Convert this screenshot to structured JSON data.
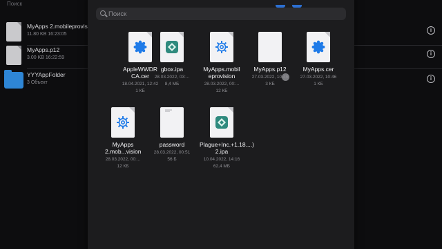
{
  "background_list": {
    "search_placeholder": "Поиск",
    "rows": [
      {
        "name": "MyApps 2.mobileprovision",
        "meta": "11.80 KB  16:23:05",
        "kind": "doc"
      },
      {
        "name": "MyApps.p12",
        "meta": "3.00 KB  16:22:59",
        "kind": "doc"
      },
      {
        "name": "YYYAppFolder",
        "meta": "3 Объект",
        "kind": "folder"
      }
    ]
  },
  "picker": {
    "search_placeholder": "Поиск",
    "files": [
      {
        "label": "AppleWWDRCA.cer",
        "date": "18.04.2021, 12:42",
        "size": "1 КБ",
        "icon": "cert-seal-icon"
      },
      {
        "label": "gbox.ipa",
        "date": "28.03.2022, 03:...",
        "size": "8,4 МБ",
        "icon": "gbox-app-icon"
      },
      {
        "label": "MyApps.mobileprovision",
        "date": "28.03.2022, 00:...",
        "size": "12 КБ",
        "icon": "gear-icon"
      },
      {
        "label": "MyApps.p12",
        "date": "27.03.2022, 10:46",
        "size": "3 КБ",
        "icon": "blank-doc-icon"
      },
      {
        "label": "MyApps.cer",
        "date": "27.03.2022, 10:46",
        "size": "1 КБ",
        "icon": "cert-seal-icon"
      },
      {
        "label": "MyApps 2.mob...vision",
        "date": "28.03.2022, 00:...",
        "size": "12 КБ",
        "icon": "gear-icon"
      },
      {
        "label": "password",
        "date": "28.03.2022, 00:51",
        "size": "56 Б",
        "icon": "text-doc-icon"
      },
      {
        "label": "Plague+Inc.+1.18....) 2.ipa",
        "date": "10.04.2022, 14:16",
        "size": "62,4 МБ",
        "icon": "ipa-app-icon"
      }
    ]
  }
}
